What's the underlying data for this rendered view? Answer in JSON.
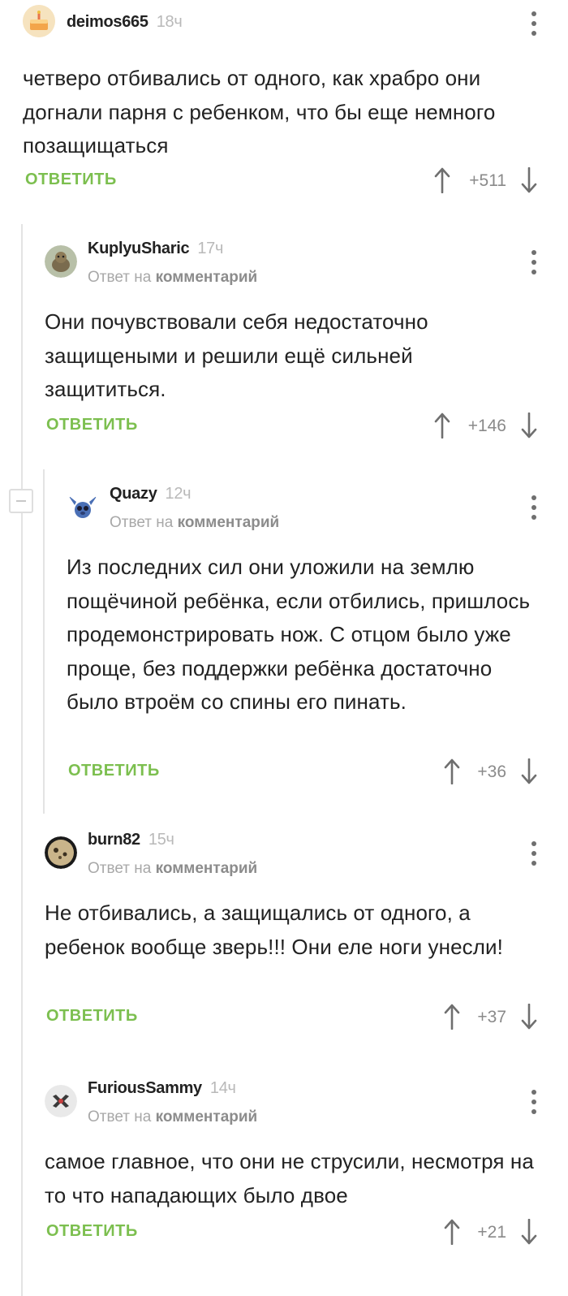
{
  "reply_label": "ОТВЕТИТЬ",
  "reply_prefix": "Ответ на",
  "reply_target": "комментарий",
  "comments": [
    {
      "author": "deimos665",
      "time": "18ч",
      "avatar_icon": "cake-avatar-icon",
      "text": "четверо отбивались от одного, как храбро они догнали парня с ребенком, что бы еще немного позащищаться",
      "score": "+511"
    },
    {
      "author": "KuplyuSharic",
      "time": "17ч",
      "avatar_icon": "animal-avatar-icon",
      "text": "Они почувствовали себя недостаточно защищеными и решили ещё сильней защититься.",
      "score": "+146"
    },
    {
      "author": "Quazy",
      "time": "12ч",
      "avatar_icon": "stitch-avatar-icon",
      "text": "Из последних сил они уложили на землю пощёчиной ребёнка, если отбились, пришлось продемонстрировать нож. С отцом было уже проще, без поддержки ребёнка достаточно было втроём со спины его пинать.",
      "score": "+36"
    },
    {
      "author": "burn82",
      "time": "15ч",
      "avatar_icon": "dark-round-avatar-icon",
      "text": "Не отбивались, а защищались от одного, а ребенок вообще зверь!!! Они еле ноги унесли!",
      "score": "+37"
    },
    {
      "author": "FuriousSammy",
      "time": "14ч",
      "avatar_icon": "robot-avatar-icon",
      "text": "самое главное, что они не струсили, несмотря на то что нападающих было двое",
      "score": "+21"
    }
  ],
  "colors": {
    "reply_green": "#7cbf4f",
    "thread_line": "#e3e3e3",
    "muted_text": "#a8a8a8"
  }
}
